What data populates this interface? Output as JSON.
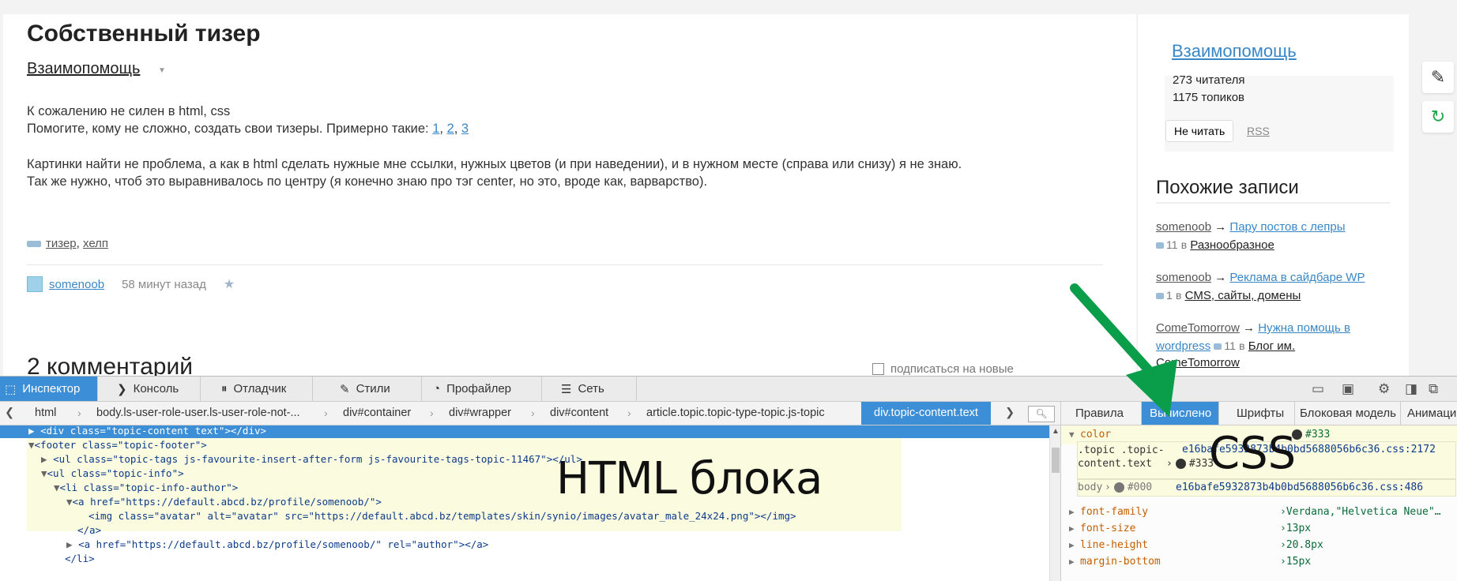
{
  "page": {
    "title": "Собственный тизер",
    "blog": "Взаимопомощь",
    "text_lines": [
      "К сожалению не силен в html, css",
      "Помогите, кому не сложно, создать свои тизеры. Примерно такие: ",
      "Картинки найти не проблема, а как в html сделать нужные мне ссылки, нужных цветов (и при наведении), и в нужном месте (справа или снизу) я не знаю.",
      "Так же нужно, чтоб это выравнивалось по центру (я конечно знаю про тэг center, но это, вроде как, варварство)."
    ],
    "example_links": [
      "1",
      "2",
      "3"
    ],
    "tags": [
      "тизер",
      "хелп"
    ],
    "author": "somenoob",
    "time": "58 минут назад",
    "comments_title": "2 комментарий",
    "subscribe": "подписаться на новые"
  },
  "sidebar": {
    "blog_title": "Взаимопомощь",
    "readers": "273 читателя",
    "topics": "1175 топиков",
    "unread_button": "Не читать",
    "rss": "RSS",
    "similar_title": "Похожие записи",
    "similar": [
      {
        "author": "somenoob",
        "title": "Пару постов с лепры",
        "count": "11",
        "blog": "Разнообразное"
      },
      {
        "author": "somenoob",
        "title": "Реклама в сайдбаре WP",
        "count": "1",
        "blog": "CMS, сайты, домены"
      },
      {
        "author": "ComeTomorrow",
        "title": "Нужна помощь в",
        "title2": "wordpress",
        "count": "11",
        "blog": "Блог им.",
        "blog2": "ComeTomorrow"
      }
    ],
    "arrow": "→",
    "in": "в"
  },
  "devtools": {
    "tabs": [
      "Инспектор",
      "Консоль",
      "Отладчик",
      "Стили",
      "Профайлер",
      "Сеть"
    ],
    "breadcrumbs": [
      "html",
      "body.ls-user-role-user.ls-user-role-not-...",
      "div#container",
      "div#wrapper",
      "div#content",
      "article.topic.topic-type-topic.js-topic",
      "div.topic-content.text"
    ],
    "html_lines": [
      "<div class=\"topic-content text\"></div>",
      "<footer class=\"topic-footer\">",
      "<ul class=\"topic-tags js-favourite-insert-after-form js-favourite-tags-topic-11467\"></ul>",
      "<ul class=\"topic-info\">",
      "<li class=\"topic-info-author\">",
      "<a href=\"https://default.abcd.bz/profile/somenoob/\">",
      "<img class=\"avatar\" alt=\"avatar\" src=\"https://default.abcd.bz/templates/skin/synio/images/avatar_male_24x24.png\"></img>",
      "</a>",
      "<a href=\"https://default.abcd.bz/profile/somenoob/\" rel=\"author\"></a>",
      "</li>"
    ],
    "css_tabs": [
      "Правила",
      "Вычислено",
      "Шрифты",
      "Блоковая модель",
      "Анимации"
    ],
    "computed": {
      "color": {
        "name": "color",
        "value": "#333"
      },
      "rules": [
        {
          "selector": ".topic .topic-content.text",
          "value": "#333",
          "source": "e16bafe5932873b4b0bd5688056b6c36.css:2172"
        },
        {
          "selector": "body",
          "value": "#000",
          "source": "e16bafe5932873b4b0bd5688056b6c36.css:486"
        }
      ],
      "props": [
        {
          "name": "font-family",
          "value": "Verdana,\"Helvetica Neue\"…"
        },
        {
          "name": "font-size",
          "value": "13px"
        },
        {
          "name": "line-height",
          "value": "20.8px"
        },
        {
          "name": "margin-bottom",
          "value": "15px"
        }
      ]
    }
  },
  "annotations": {
    "html": "HTML блока",
    "css": "CSS"
  },
  "colors": {
    "link": "#3a87c7",
    "devtools_accent": "#3c8fd6",
    "arrow": "#0a9d4a",
    "highlight": "#fbfbdf"
  }
}
